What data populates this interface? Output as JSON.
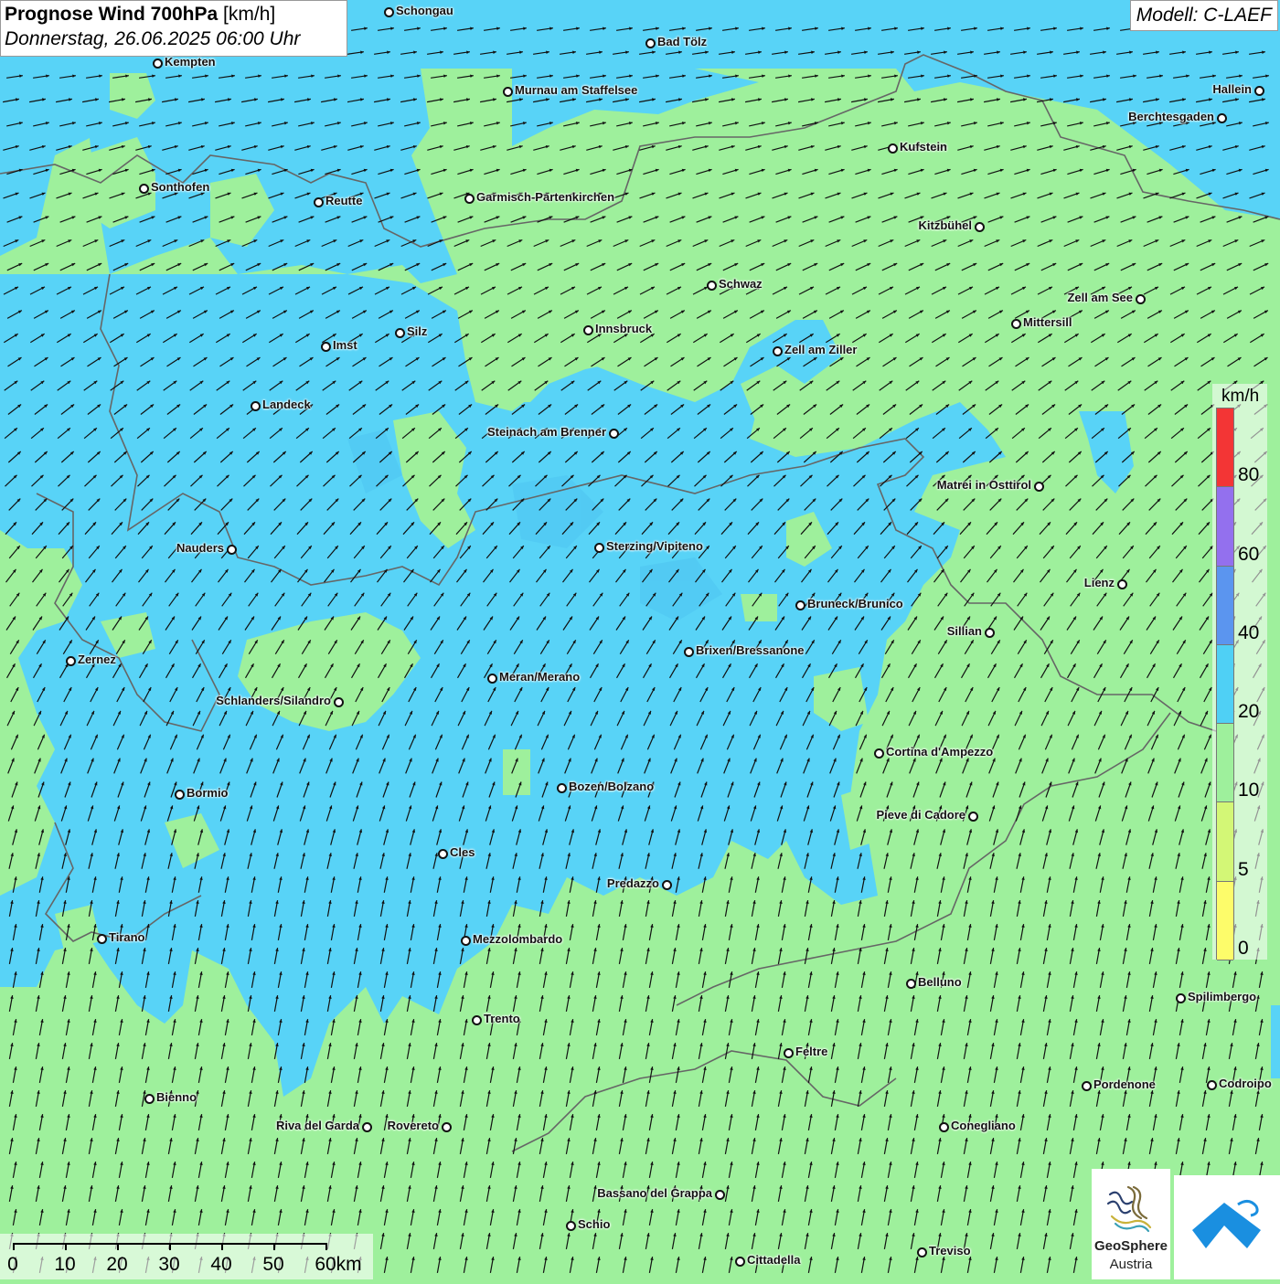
{
  "title": {
    "bold": "Prognose Wind 700hPa",
    "unit": "[km/h]",
    "date": "Donnerstag, 26.06.2025 06:00 Uhr"
  },
  "model": "Modell: C-LAEF",
  "colors": {
    "band_10_20": "#9ef09c",
    "band_20_40": "#58d3f7",
    "band_40_60": "#5aa0f0",
    "arrow": "#111111",
    "border": "#666666"
  },
  "legend": {
    "unit": "km/h",
    "levels": [
      {
        "label": "0",
        "color": "#fdfc6a"
      },
      {
        "label": "5",
        "color": "#d3f776"
      },
      {
        "label": "10",
        "color": "#9ef09c"
      },
      {
        "label": "20",
        "color": "#4fd0f5"
      },
      {
        "label": "40",
        "color": "#5b95ef"
      },
      {
        "label": "60",
        "color": "#9370ee"
      },
      {
        "label": "80",
        "color": "#f33535"
      }
    ]
  },
  "scale": {
    "labels": [
      "0",
      "10",
      "20",
      "30",
      "40",
      "50",
      "60km"
    ]
  },
  "logo": {
    "line1": "GeoSphere",
    "line2": "Austria",
    "icon": "geosphere-logo-icon",
    "app_icon": "wind-app-icon"
  },
  "places": [
    {
      "name": "Schongau"
    },
    {
      "name": "Bad Tölz"
    },
    {
      "name": "Kempten"
    },
    {
      "name": "Murnau am Staffelsee"
    },
    {
      "name": "Hallein"
    },
    {
      "name": "Berchtesgaden"
    },
    {
      "name": "Kufstein"
    },
    {
      "name": "Sonthofen"
    },
    {
      "name": "Reutte"
    },
    {
      "name": "Garmisch-Partenkirchen"
    },
    {
      "name": "Kitzbühel"
    },
    {
      "name": "Schwaz"
    },
    {
      "name": "Zell am See"
    },
    {
      "name": "Mittersill"
    },
    {
      "name": "Innsbruck"
    },
    {
      "name": "Silz"
    },
    {
      "name": "Imst"
    },
    {
      "name": "Zell am Ziller"
    },
    {
      "name": "Landeck"
    },
    {
      "name": "Steinach am Brenner"
    },
    {
      "name": "Matrei in Osttirol"
    },
    {
      "name": "Nauders"
    },
    {
      "name": "Sterzing/Vipiteno"
    },
    {
      "name": "Lienz"
    },
    {
      "name": "Bruneck/Brunico"
    },
    {
      "name": "Sillian"
    },
    {
      "name": "Brixen/Bressanone"
    },
    {
      "name": "Zernez"
    },
    {
      "name": "Meran/Merano"
    },
    {
      "name": "Schlanders/Silandro"
    },
    {
      "name": "Cortina d'Ampezzo"
    },
    {
      "name": "Bozen/Bolzano"
    },
    {
      "name": "Bormio"
    },
    {
      "name": "Pieve di Cadore"
    },
    {
      "name": "Cles"
    },
    {
      "name": "Predazzo"
    },
    {
      "name": "Tirano"
    },
    {
      "name": "Mezzolombardo"
    },
    {
      "name": "Belluno"
    },
    {
      "name": "Spilimbergo"
    },
    {
      "name": "Trento"
    },
    {
      "name": "Feltre"
    },
    {
      "name": "Pordenone"
    },
    {
      "name": "Codroipo"
    },
    {
      "name": "Bienno"
    },
    {
      "name": "Riva del Garda"
    },
    {
      "name": "Rovereto"
    },
    {
      "name": "Conegliano"
    },
    {
      "name": "Bassano del Grappa"
    },
    {
      "name": "Schio"
    },
    {
      "name": "Treviso"
    },
    {
      "name": "Cittadella"
    }
  ]
}
